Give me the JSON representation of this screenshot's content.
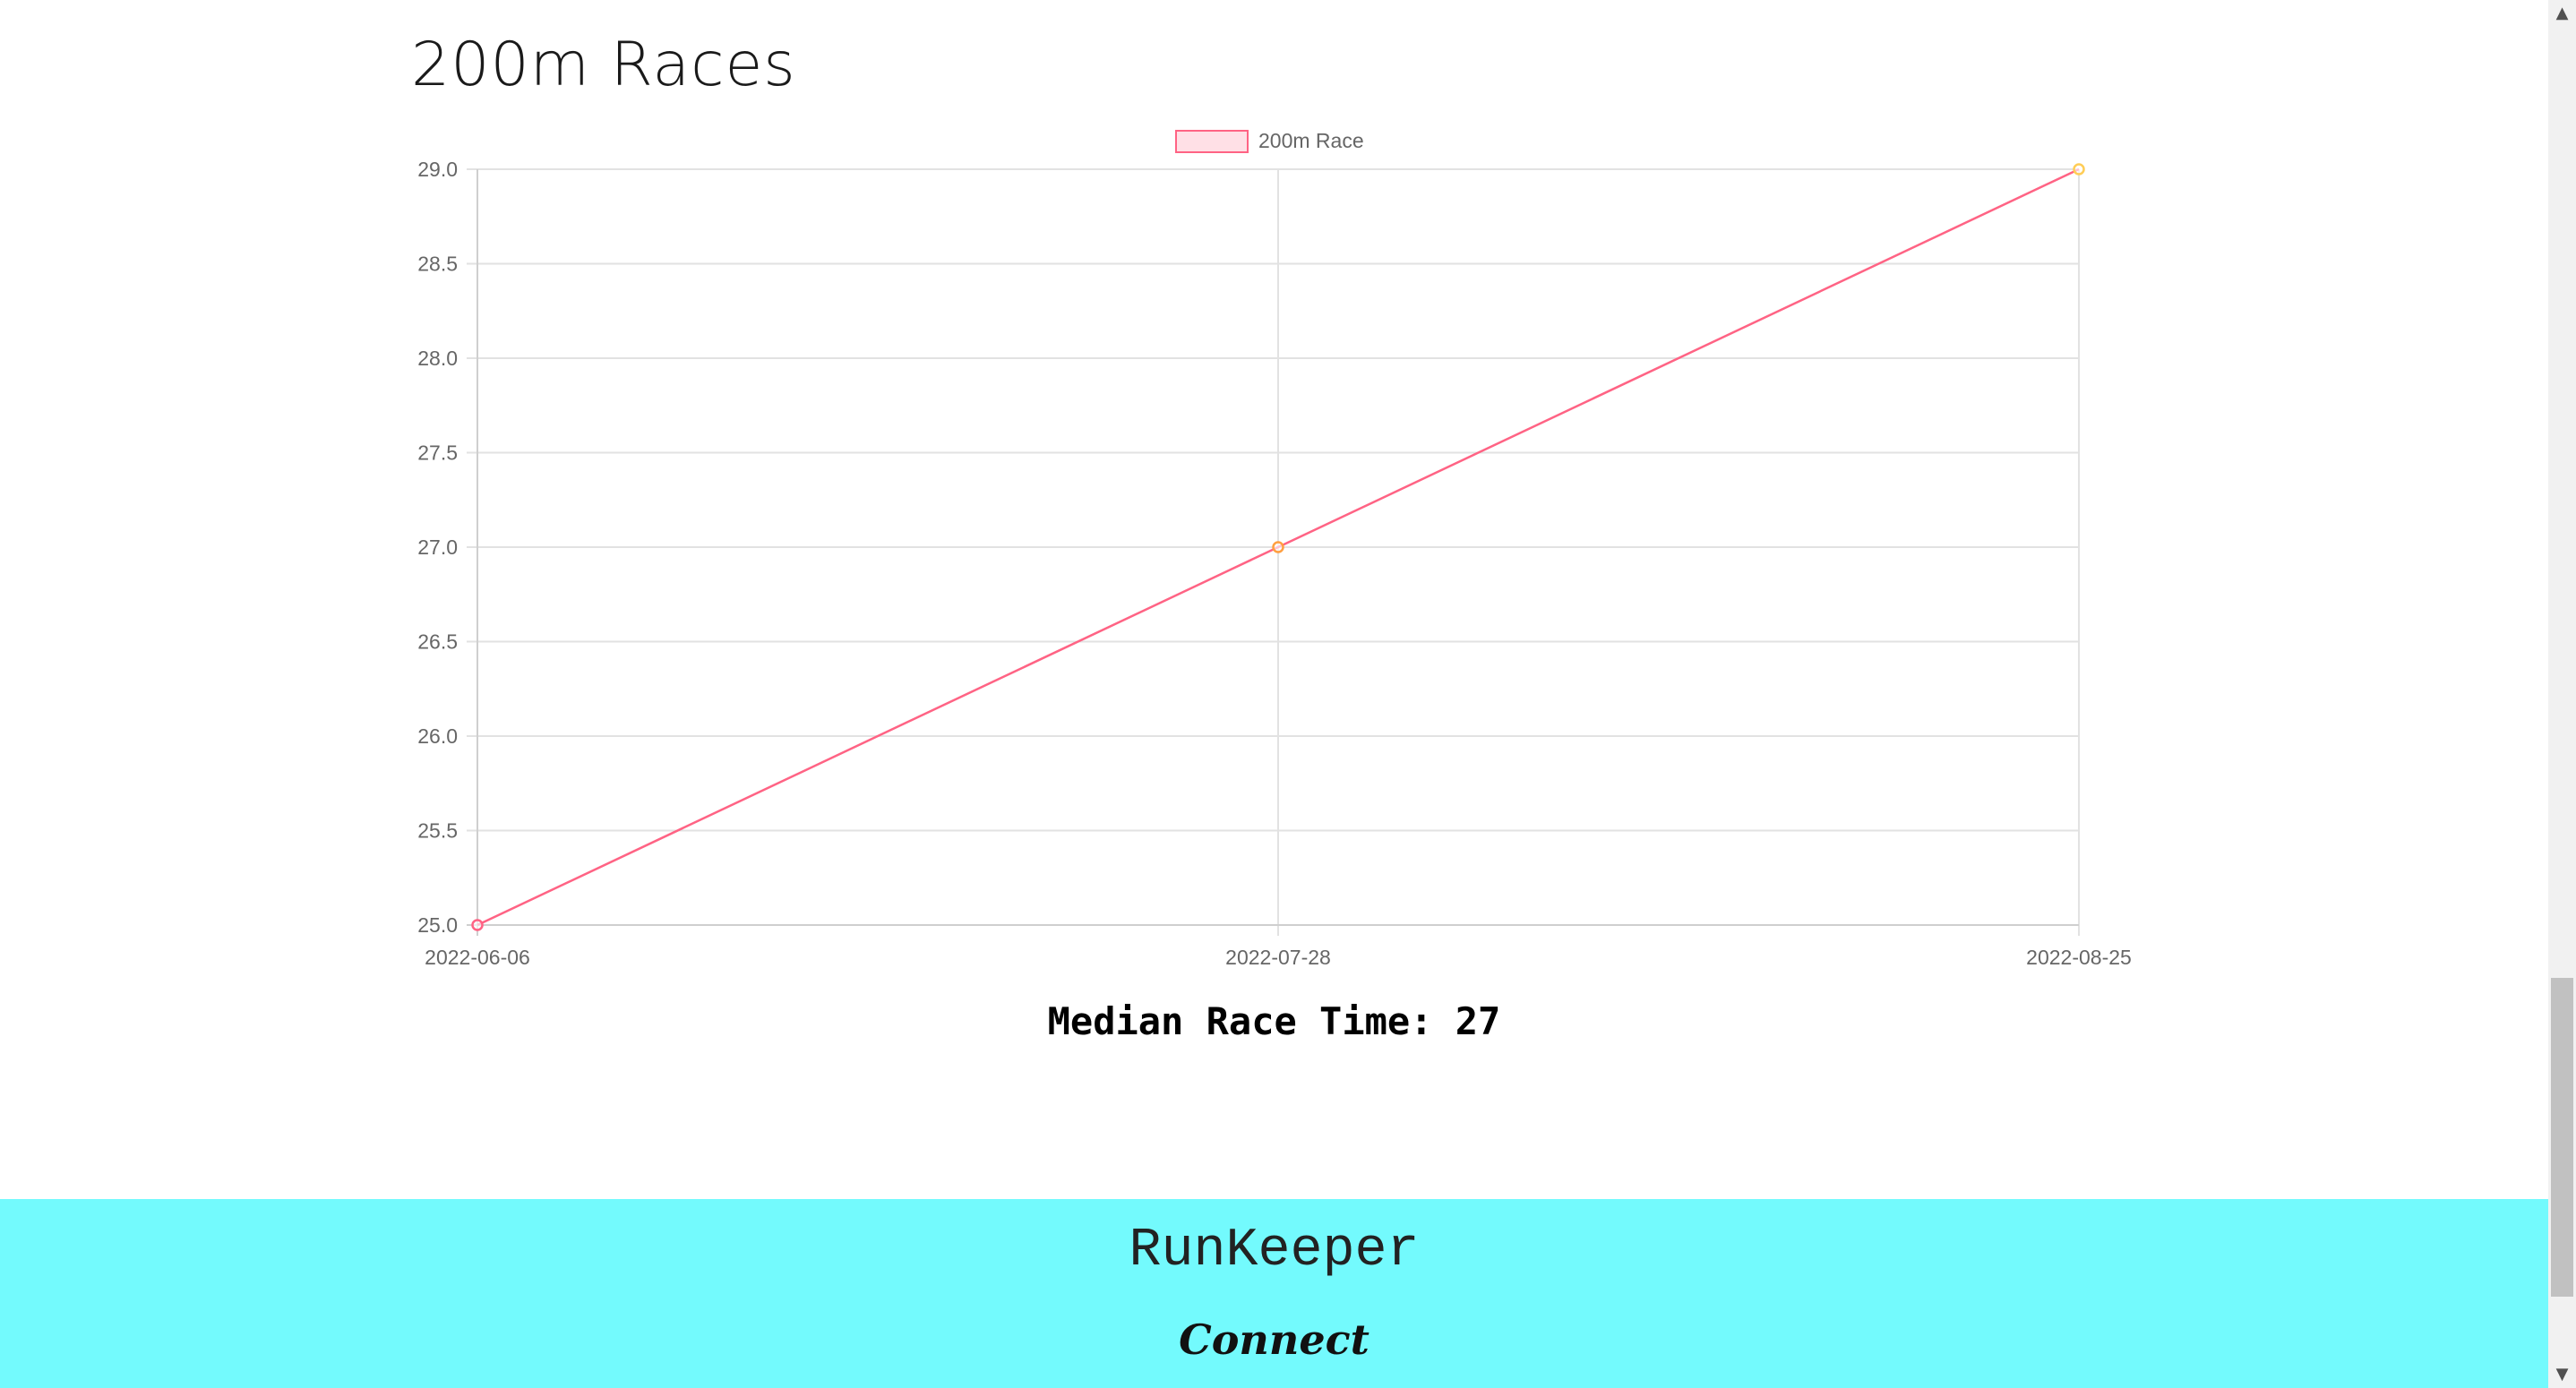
{
  "page": {
    "title": "200m Races"
  },
  "chart_data": {
    "type": "line",
    "x": [
      "2022-06-06",
      "2022-07-28",
      "2022-08-25"
    ],
    "series": [
      {
        "name": "200m Race",
        "values": [
          25,
          27,
          29
        ],
        "color": "#ff6384",
        "point_colors": [
          "#ff6384",
          "#ff9f40",
          "#ffcd56"
        ]
      }
    ],
    "ylim": [
      25,
      29
    ],
    "y_ticks": [
      "25.0",
      "25.5",
      "26.0",
      "26.5",
      "27.0",
      "27.5",
      "28.0",
      "28.5",
      "29.0"
    ],
    "grid": true,
    "legend": "top-center",
    "xlabel": "",
    "ylabel": ""
  },
  "stats": {
    "median_label": "Median Race Time: 27"
  },
  "footer": {
    "brand": "RunKeeper",
    "connect": "Connect",
    "background": "#73fafd"
  }
}
